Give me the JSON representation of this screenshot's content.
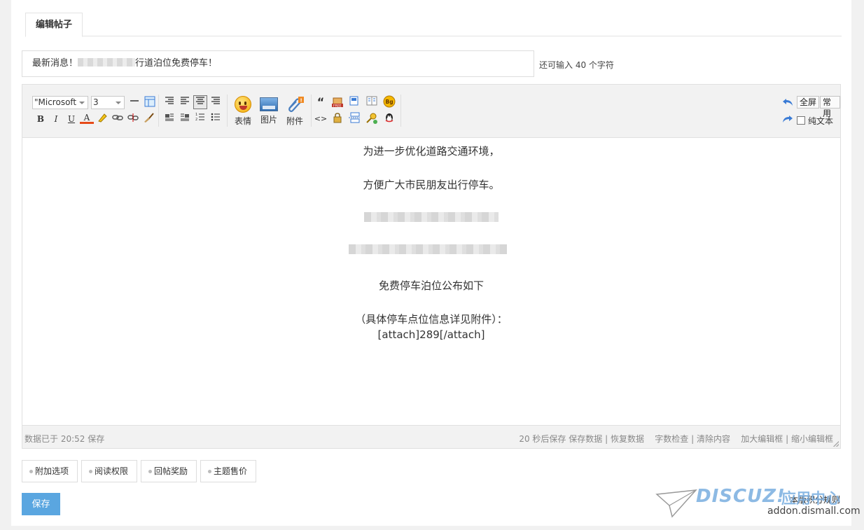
{
  "tab": {
    "label": "编辑帖子"
  },
  "subject": {
    "prefix": "最新消息！",
    "suffix": "行道泊位免费停车！"
  },
  "counter": "还可输入 40 个字符",
  "toolbar": {
    "font_select": "\"Microsoft",
    "size_select": "3",
    "emoticon_label": "表情",
    "image_label": "图片",
    "attach_label": "附件",
    "fullscreen_label": "全屏",
    "common_label": "常用",
    "plaintext_label": "纯文本",
    "glyphs": {
      "bold": "B",
      "italic": "I",
      "underline": "U",
      "color": "A",
      "quote": "“",
      "code": "<>"
    },
    "icons": [
      "emoticon-icon",
      "image-icon",
      "attachment-icon"
    ]
  },
  "content": {
    "lines": [
      "为进一步优化道路交通环境，",
      "方便广大市民朋友出行停车。",
      "免费停车泊位公布如下",
      "（具体停车点位信息详见附件）：",
      "[attach]289[/attach]"
    ]
  },
  "statusbar": {
    "saved": "数据已于 20:52 保存",
    "autosave": "20 秒后保存",
    "save_data": "保存数据",
    "restore_data": "恢复数据",
    "word_check": "字数检查",
    "clear": "清除内容",
    "enlarge": "加大编辑框",
    "shrink": "缩小编辑框",
    "divider": "|"
  },
  "options": [
    "附加选项",
    "阅读权限",
    "回帖奖励",
    "主题售价"
  ],
  "save_button": "保存",
  "rules_link": "本版积分规则",
  "watermark": {
    "logo": "DISCUZ!",
    "cn": "应用中心",
    "url": "addon.dismall.com"
  },
  "colors": {
    "save_bg": "#5aa6e0",
    "toolbar_bg": "#f2f2f2",
    "accent_blue": "#3a7bd5"
  }
}
